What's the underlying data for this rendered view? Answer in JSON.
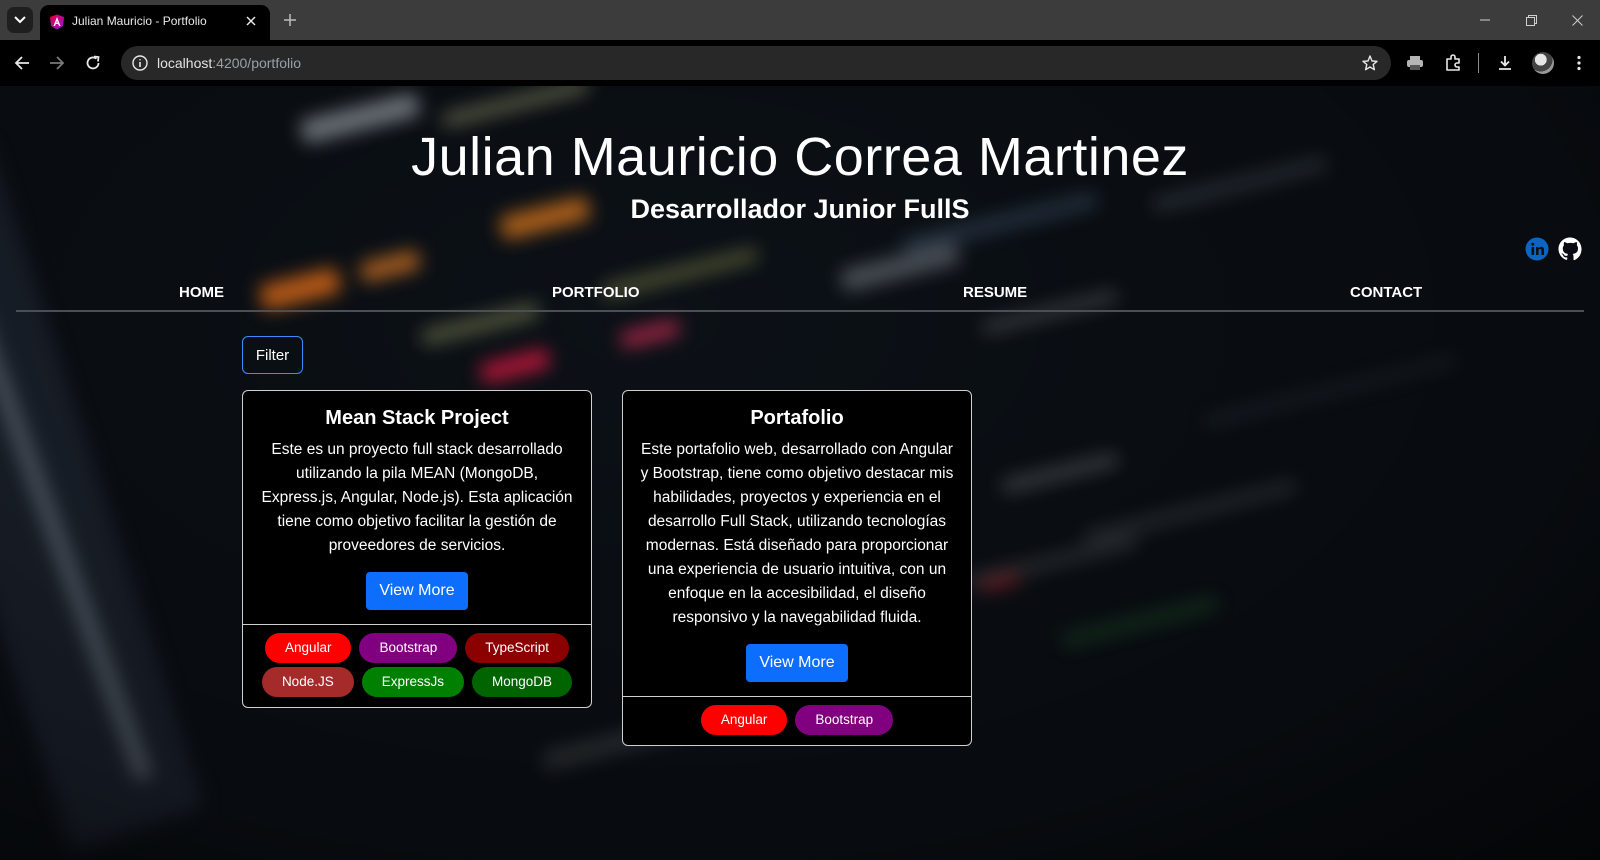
{
  "browser": {
    "tab_title": "Julian Mauricio - Portfolio",
    "url_host": "localhost",
    "url_rest": ":4200/portfolio"
  },
  "hero": {
    "name": "Julian Mauricio Correa Martinez",
    "role": "Desarrollador Junior FullS"
  },
  "nav": {
    "home": "HOME",
    "portfolio": "PORTFOLIO",
    "resume": "RESUME",
    "contact": "CONTACT"
  },
  "filter_label": "Filter",
  "cards": [
    {
      "title": "Mean Stack Project",
      "text": "Este es un proyecto full stack desarrollado utilizando la pila MEAN (MongoDB, Express.js, Angular, Node.js). Esta aplicación tiene como objetivo facilitar la gestión de proveedores de servicios.",
      "button": "View More",
      "tags": [
        {
          "label": "Angular",
          "color": "#ff0000"
        },
        {
          "label": "Bootstrap",
          "color": "#800080"
        },
        {
          "label": "TypeScript",
          "color": "#8b0000"
        },
        {
          "label": "Node.JS",
          "color": "#a52a2a"
        },
        {
          "label": "ExpressJs",
          "color": "#008000"
        },
        {
          "label": "MongoDB",
          "color": "#006400"
        }
      ]
    },
    {
      "title": "Portafolio",
      "text": "Este portafolio web, desarrollado con Angular y Bootstrap, tiene como objetivo destacar mis habilidades, proyectos y experiencia en el desarrollo Full Stack, utilizando tecnologías modernas. Está diseñado para proporcionar una experiencia de usuario intuitiva, con un enfoque en la accesibilidad, el diseño responsivo y la navegabilidad fluida.",
      "button": "View More",
      "tags": [
        {
          "label": "Angular",
          "color": "#ff0000"
        },
        {
          "label": "Bootstrap",
          "color": "#800080"
        }
      ]
    }
  ],
  "colors": {
    "accent": "#0d6efd",
    "filter_border": "#3d8bfd",
    "linkedin": "#0a66c2"
  },
  "icons": [
    "tab-search-icon",
    "angular-favicon-icon",
    "close-icon",
    "plus-icon",
    "minimize-icon",
    "restore-icon",
    "back-icon",
    "forward-icon",
    "reload-icon",
    "site-info-icon",
    "star-icon",
    "printer-icon",
    "extensions-icon",
    "download-icon",
    "menu-icon",
    "linkedin-icon",
    "github-icon"
  ]
}
